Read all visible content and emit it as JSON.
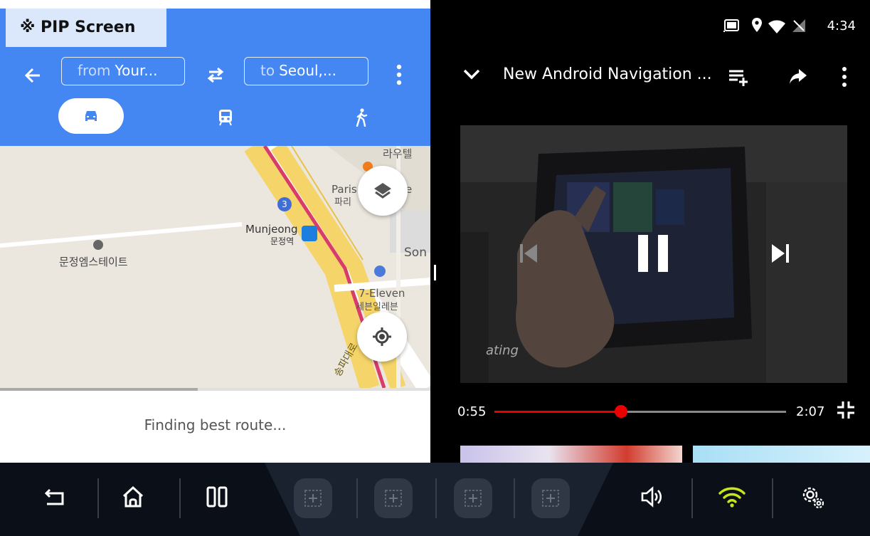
{
  "pip": {
    "label": "※ PIP Screen"
  },
  "maps": {
    "route": {
      "from_prefix": "from",
      "from_value": "Your...",
      "to_prefix": "to",
      "to_value": "Seoul,..."
    },
    "modes": [
      "car",
      "transit",
      "walk"
    ],
    "selected_mode": "car",
    "map_labels": {
      "paris": "Paris",
      "paris_kr": "파리",
      "e": "e",
      "rautel": "라우텔",
      "munjeong": "Munjeong",
      "munjeong_kr": "문정역",
      "son": "Son",
      "seven_eleven": "7-Eleven",
      "seven_eleven_kr": "세븐일레븐",
      "estate_kr": "문정엠스테이트",
      "road_kr": "송파대로",
      "route_number": "3"
    },
    "loading_progress": 0.46,
    "status_text": "Finding best route..."
  },
  "status_bar": {
    "time": "4:34"
  },
  "youtube": {
    "title": "New Android Navigation ...",
    "elapsed": "0:55",
    "duration": "2:07",
    "progress_fraction": 0.434,
    "overlay_caption": "ating"
  },
  "colors": {
    "maps_blue": "#4487f2",
    "pip_label_bg": "#dbe8fb",
    "seek_red": "#e00000",
    "wifi_green": "#c6e61a",
    "taskbar_bg": "#0b1018"
  },
  "taskbar": {
    "left_buttons": [
      "back-icon",
      "home-icon",
      "split-screen-icon"
    ],
    "empty_slots": 4,
    "right_buttons": [
      "volume-icon",
      "wifi-icon",
      "settings-icon"
    ]
  }
}
